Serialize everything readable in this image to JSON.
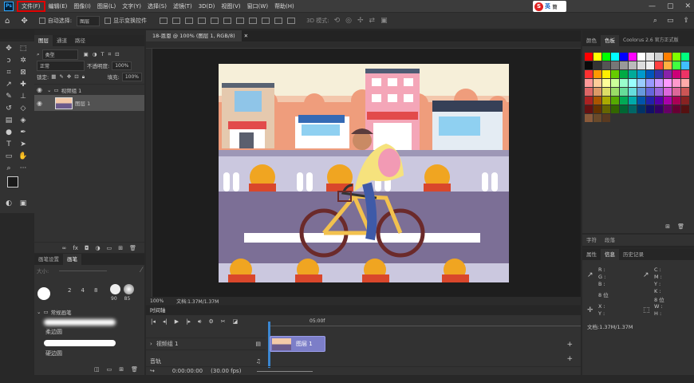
{
  "menubar": {
    "app_logo": "Ps",
    "items": [
      "文件(F)",
      "编辑(E)",
      "图像(I)",
      "图层(L)",
      "文字(Y)",
      "选择(S)",
      "滤镜(T)",
      "3D(D)",
      "视图(V)",
      "窗口(W)",
      "帮助(H)"
    ],
    "ime_brand": "英",
    "ime_extra": "簡",
    "window_controls": [
      "—",
      "▢",
      "✕"
    ]
  },
  "options": {
    "auto_select_label": "自动选择:",
    "auto_select_value": "图层",
    "show_transform_label": "显示变换控件",
    "mode_3d_label": "3D 模式:"
  },
  "layers": {
    "tabs": [
      "图层",
      "通道",
      "路径"
    ],
    "filter_kind": "类型",
    "blend_mode": "正常",
    "opacity_label": "不透明度:",
    "opacity_value": "100%",
    "lock_label": "锁定:",
    "fill_label": "填充:",
    "fill_value": "100%",
    "group_name": "视频组 1",
    "layer_name": "图层 1"
  },
  "brush": {
    "tabs": [
      "画笔设置",
      "画笔"
    ],
    "size_label": "大小:",
    "presets": [
      "2",
      "4",
      "8",
      "90",
      "85"
    ],
    "folder": "常规画笔",
    "brushes": [
      "柔边圆",
      "硬边圆"
    ]
  },
  "document": {
    "tab": "18-恩恩 @ 100% (图层 1, RGB/8)",
    "zoom": "100%",
    "doc_info": "文档:1.37M/1.37M"
  },
  "timeline": {
    "title": "时间轴",
    "time_marker": "05:00f",
    "track": "视频组 1",
    "clip_name": "图层 1",
    "audio_track": "音轨",
    "current_time": "0:00:00:00",
    "fps": "(30.00 fps)"
  },
  "swatches": {
    "tabs": [
      "颜色",
      "色板",
      "Coolorus 2.6 官方正式版"
    ],
    "colors": [
      "#ff0000",
      "#ffff00",
      "#00ff00",
      "#00ffff",
      "#0000ff",
      "#ff00ff",
      "#ffffff",
      "#e8e8e8",
      "#d0d0d0",
      "#ff7f00",
      "#7fff00",
      "#00ff7f",
      "#0a0a0a",
      "#333333",
      "#555555",
      "#777777",
      "#999999",
      "#bbbbbb",
      "#dddddd",
      "#f0f0f0",
      "#ff4040",
      "#ffb040",
      "#40ff40",
      "#40c0ff",
      "#ff3030",
      "#ff9900",
      "#ffee00",
      "#66cc00",
      "#00aa44",
      "#00aa99",
      "#0099cc",
      "#0055bb",
      "#3333aa",
      "#8822aa",
      "#cc0077",
      "#ee3366",
      "#ff9999",
      "#ffcc99",
      "#ffff99",
      "#ccff99",
      "#99ffcc",
      "#99ffff",
      "#99ccff",
      "#9999ff",
      "#cc99ff",
      "#ff99ff",
      "#ff99cc",
      "#ffaaaa",
      "#dd6666",
      "#dd9966",
      "#dddd66",
      "#99dd66",
      "#66dd99",
      "#66dddd",
      "#6699dd",
      "#6666dd",
      "#9966dd",
      "#dd66dd",
      "#dd6699",
      "#cc5555",
      "#aa2222",
      "#aa5500",
      "#aaaa00",
      "#55aa00",
      "#00aa55",
      "#00aaaa",
      "#0055aa",
      "#2222aa",
      "#5500aa",
      "#aa00aa",
      "#aa0055",
      "#882222",
      "#661111",
      "#663300",
      "#666600",
      "#336600",
      "#006633",
      "#006666",
      "#003366",
      "#111166",
      "#330066",
      "#660066",
      "#660033",
      "#551111",
      "#8a5a3a",
      "#6a4a2a",
      "#5a3a20"
    ],
    "char_tabs": [
      "字符",
      "段落"
    ],
    "info_tabs": [
      "属性",
      "信息",
      "历史记录"
    ],
    "info_rgb": [
      "R :",
      "G :",
      "B :"
    ],
    "info_cmyk": [
      "C :",
      "M :",
      "Y :",
      "K :"
    ],
    "bits": "8 位",
    "xy": [
      "X :",
      "Y :"
    ],
    "wh": [
      "W :",
      "H :"
    ],
    "doc_info": "文档:1.37M/1.37M"
  }
}
